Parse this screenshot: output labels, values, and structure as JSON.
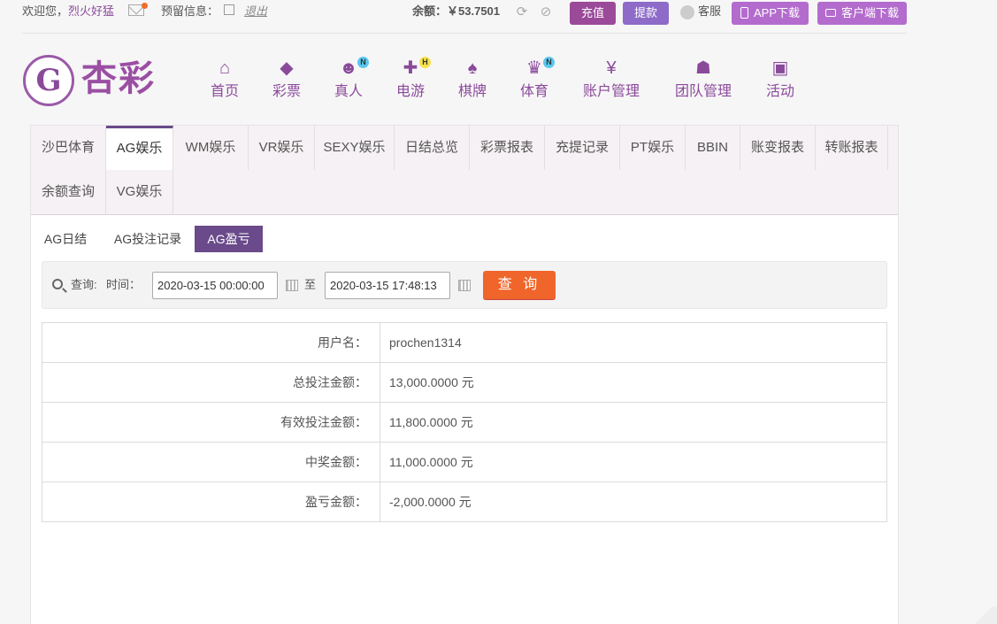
{
  "topbar": {
    "welcome": "欢迎您，",
    "username": "烈火好猛",
    "notice_label": "预留信息：",
    "logout": "退出",
    "balance_label": "余额：",
    "balance_value": "￥53.7501",
    "recharge": "充值",
    "withdraw": "提款",
    "service": "客服",
    "app_download": "APP下载",
    "client_download": "客户端下载"
  },
  "logo": {
    "text": "杏彩"
  },
  "nav": [
    {
      "label": "首页",
      "icon": "home-icon"
    },
    {
      "label": "彩票",
      "icon": "ticket-icon"
    },
    {
      "label": "真人",
      "icon": "dealer-icon",
      "badge": "N"
    },
    {
      "label": "电游",
      "icon": "gamepad-icon",
      "badge": "H"
    },
    {
      "label": "棋牌",
      "icon": "cards-icon"
    },
    {
      "label": "体育",
      "icon": "trophy-icon",
      "badge": "N"
    },
    {
      "label": "账户管理",
      "icon": "yen-icon"
    },
    {
      "label": "团队管理",
      "icon": "team-icon"
    },
    {
      "label": "活动",
      "icon": "gift-icon"
    }
  ],
  "tabs": [
    "沙巴体育",
    "AG娱乐",
    "WM娱乐",
    "VR娱乐",
    "SEXY娱乐",
    "日结总览",
    "彩票报表",
    "充提记录",
    "PT娱乐",
    "BBIN",
    "账变报表",
    "转账报表",
    "余额查询",
    "VG娱乐"
  ],
  "active_tab": "AG娱乐",
  "subtabs": [
    "AG日结",
    "AG投注记录",
    "AG盈亏"
  ],
  "active_subtab": "AG盈亏",
  "query": {
    "label": "查询:",
    "time_label": "时间：",
    "start": "2020-03-15 00:00:00",
    "separator": "至",
    "end": "2020-03-15 17:48:13",
    "button": "查 询"
  },
  "results": [
    {
      "label": "用户名：",
      "value": "prochen1314"
    },
    {
      "label": "总投注金额：",
      "value": "13,000.0000 元"
    },
    {
      "label": "有效投注金额：",
      "value": "11,800.0000 元"
    },
    {
      "label": "中奖金额：",
      "value": "11,000.0000 元"
    },
    {
      "label": "盈亏金额：",
      "value": "-2,000.0000 元"
    }
  ],
  "colors": {
    "brand": "#8a4a9a",
    "accent": "#f0652a",
    "active_tab": "#6a4a8a"
  }
}
